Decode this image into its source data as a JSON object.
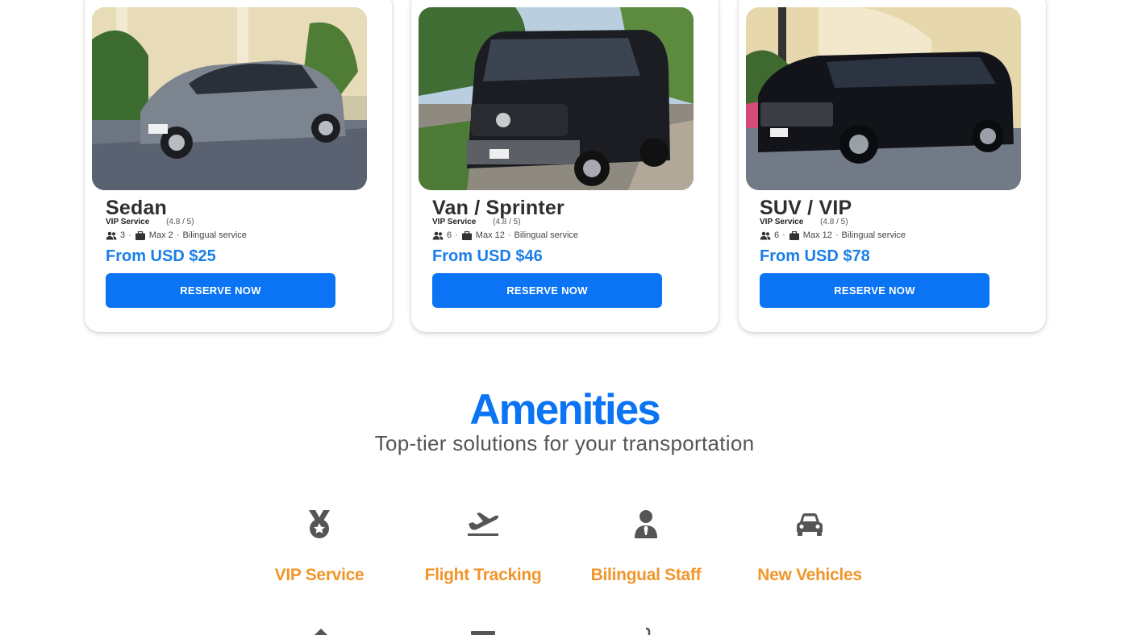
{
  "vehicles": [
    {
      "name": "Sedan",
      "service": "VIP Service",
      "rating": "(4.8 / 5)",
      "passengers": "3",
      "luggage": "Max 2",
      "extra": "Bilingual service",
      "price": "From USD $25",
      "reserve_label": "RESERVE NOW",
      "photo": "gray-sedan-photo",
      "body_color": "#7b848f"
    },
    {
      "name": "Van / Sprinter",
      "service": "VIP Service",
      "rating": "(4.8 / 5)",
      "passengers": "6",
      "luggage": "Max 12",
      "extra": "Bilingual service",
      "price": "From USD $46",
      "reserve_label": "RESERVE NOW",
      "photo": "black-sprinter-van-photo",
      "body_color": "#1b1d22"
    },
    {
      "name": "SUV / VIP",
      "service": "VIP Service",
      "rating": "(4.8 / 5)",
      "passengers": "6",
      "luggage": "Max 12",
      "extra": "Bilingual service",
      "price": "From USD $78",
      "reserve_label": "RESERVE NOW",
      "photo": "black-suv-photo",
      "body_color": "#12141a"
    }
  ],
  "amenities": {
    "title": "Amenities",
    "subtitle": "Top-tier solutions for your transportation",
    "items": [
      {
        "label": "VIP Service",
        "icon": "medal-icon"
      },
      {
        "label": "Flight Tracking",
        "icon": "plane-departure-icon"
      },
      {
        "label": "Bilingual Staff",
        "icon": "user-tie-icon"
      },
      {
        "label": "New Vehicles",
        "icon": "car-icon"
      }
    ]
  },
  "colors": {
    "accent_blue": "#0a74f5",
    "price_blue": "#1a7ee8",
    "amenity_orange": "#f0962a",
    "icon_gray": "#555555"
  }
}
